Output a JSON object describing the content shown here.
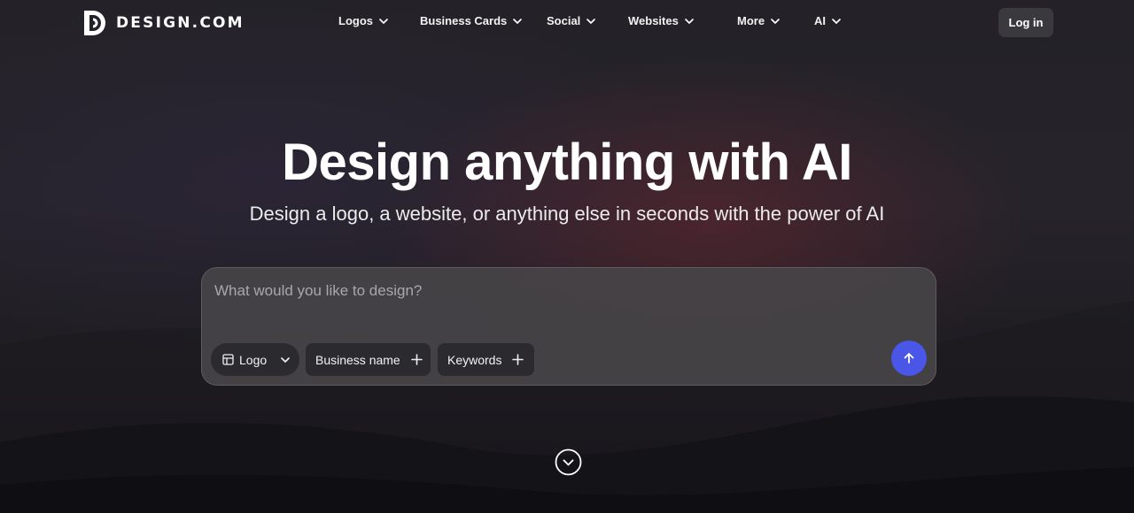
{
  "brand": {
    "name": "DESIGN.COM",
    "icon": "design-com-logo-icon"
  },
  "nav": {
    "items": [
      {
        "label": "Logos"
      },
      {
        "label": "Business Cards"
      },
      {
        "label": "Social"
      },
      {
        "label": "Websites"
      },
      {
        "label": "More"
      },
      {
        "label": "AI"
      }
    ],
    "login_label": "Log in"
  },
  "hero": {
    "title": "Design anything with AI",
    "subtitle": "Design a logo, a website, or anything else in seconds with the power of AI"
  },
  "prompt": {
    "placeholder": "What would you like to design?",
    "value": "",
    "design_type": {
      "label": "Logo",
      "icon": "layout-icon"
    },
    "chips": [
      {
        "label": "Business name",
        "icon": "plus-icon"
      },
      {
        "label": "Keywords",
        "icon": "plus-icon"
      }
    ],
    "submit_icon": "arrow-up-icon"
  },
  "scroll_icon": "chevron-down-circle-icon",
  "colors": {
    "background": "#1b1a1f",
    "accent": "#4a56e8",
    "login_bg": "#3a393d",
    "chip_bg": "#2b2a2e"
  }
}
